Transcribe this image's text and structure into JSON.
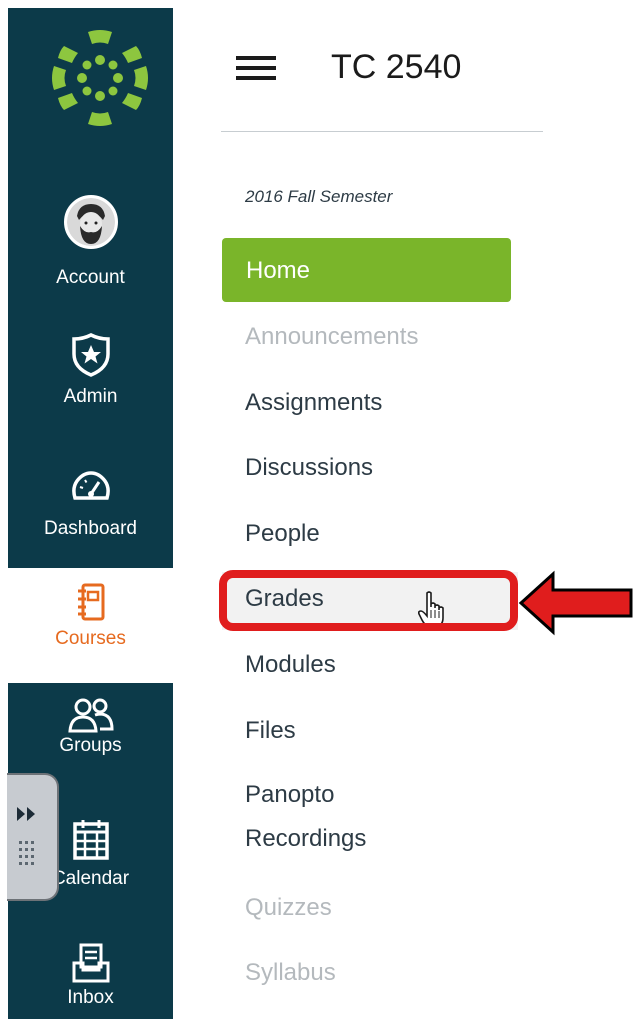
{
  "global_nav": {
    "items": [
      {
        "label": "Account",
        "icon": "avatar-icon"
      },
      {
        "label": "Admin",
        "icon": "shield-star-icon"
      },
      {
        "label": "Dashboard",
        "icon": "speedometer-icon"
      },
      {
        "label": "Courses",
        "icon": "book-icon",
        "active": true
      },
      {
        "label": "Groups",
        "icon": "people-icon"
      },
      {
        "label": "Calendar",
        "icon": "calendar-icon"
      },
      {
        "label": "Inbox",
        "icon": "inbox-icon"
      }
    ]
  },
  "course": {
    "title": "TC 2540",
    "term": "2016 Fall Semester"
  },
  "course_nav": {
    "items": [
      {
        "label": "Home",
        "state": "active"
      },
      {
        "label": "Announcements",
        "state": "disabled"
      },
      {
        "label": "Assignments",
        "state": "enabled"
      },
      {
        "label": "Discussions",
        "state": "enabled"
      },
      {
        "label": "People",
        "state": "enabled"
      },
      {
        "label": "Grades",
        "state": "hovered"
      },
      {
        "label": "Modules",
        "state": "enabled"
      },
      {
        "label": "Files",
        "state": "enabled"
      },
      {
        "label": "Panopto Recordings",
        "line1": "Panopto",
        "line2": "Recordings",
        "state": "enabled"
      },
      {
        "label": "Quizzes",
        "state": "disabled"
      },
      {
        "label": "Syllabus",
        "state": "disabled"
      }
    ]
  },
  "colors": {
    "nav_bg": "#0c3a49",
    "logo": "#8dc63f",
    "home_active": "#7ab52a",
    "courses_accent": "#e66a1f",
    "annotation_red": "#e01d1d"
  }
}
